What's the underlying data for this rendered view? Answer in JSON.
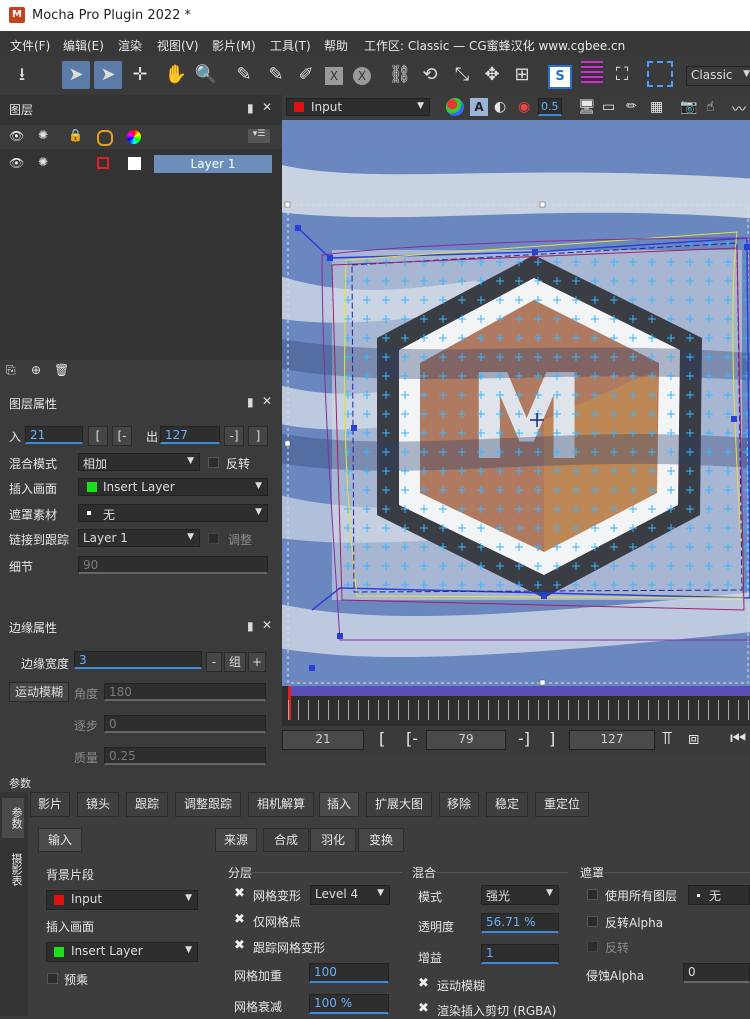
{
  "window": {
    "title": "Mocha Pro Plugin 2022 *",
    "app_icon": "M"
  },
  "menu": [
    "文件(F)",
    "编辑(E)",
    "渲染",
    "视图(V)",
    "影片(M)",
    "工具(T)",
    "帮助",
    "工作区: Classic — CG蜜蜂汉化 www.cgbee.cn"
  ],
  "toolbar": {
    "workspace_select": "Classic"
  },
  "layers_panel": {
    "title": "图层",
    "layers": [
      {
        "name": "Layer 1"
      }
    ]
  },
  "viewer": {
    "clip_select": "Input",
    "clip_color": "#e01010",
    "opacity_value": "0.5"
  },
  "layer_props": {
    "title": "图层属性",
    "in_label": "入",
    "in_value": "21",
    "out_label": "出",
    "out_value": "127",
    "blend_label": "混合模式",
    "blend_value": "相加",
    "invert_label": "反转",
    "insert_label": "插入画面",
    "insert_value": "Insert Layer",
    "matte_label": "遮罩素材",
    "matte_value": "无",
    "link_label": "链接到跟踪",
    "link_value": "Layer 1",
    "adjust_label": "调整",
    "detail_label": "细节",
    "detail_value": "90",
    "in_btns": [
      "[",
      "[-"
    ],
    "out_btns": [
      "-]",
      "]"
    ]
  },
  "edge_props": {
    "title": "边缘属性",
    "width_label": "边缘宽度",
    "width_value": "3",
    "group_btn": "组",
    "minus_btn": "-",
    "plus_btn": "+",
    "motion_blur_btn": "运动模糊",
    "angle_label": "角度",
    "angle_value": "180",
    "step_label": "逐步",
    "step_value": "0",
    "quality_label": "质量",
    "quality_value": "0.25",
    "params_label": "参数"
  },
  "timeline": {
    "current_frame": "21",
    "mid_frame": "79",
    "end_frame": "127",
    "btns": [
      "[",
      "[-",
      "-]",
      "]"
    ]
  },
  "side_tabs": [
    "参数",
    "摄影表"
  ],
  "bottom_tabs": [
    "影片",
    "镜头",
    "跟踪",
    "调整跟踪",
    "相机解算",
    "插入",
    "扩展大图",
    "移除",
    "稳定",
    "重定位"
  ],
  "insert_panel": {
    "input_tab": "输入",
    "subtabs": [
      "来源",
      "合成",
      "羽化",
      "变换"
    ],
    "bg_clip_label": "背景片段",
    "bg_clip_value": "Input",
    "insert_clip_label": "插入画面",
    "insert_clip_value": "Insert Layer",
    "premult_label": "预乘",
    "layers_section": "分层",
    "mesh_warp_label": "网格变形",
    "mesh_warp_value": "Level 4",
    "mesh_only_label": "仅网格点",
    "track_mesh_label": "跟踪网格变形",
    "mesh_weight_label": "网格加重",
    "mesh_weight_value": "100",
    "mesh_decay_label": "网格衰减",
    "mesh_decay_value": "100 %",
    "blend_section": "混合",
    "mode_label": "模式",
    "mode_value": "强光",
    "opacity_label": "透明度",
    "opacity_value": "56.71 %",
    "gain_label": "增益",
    "gain_value": "1",
    "motion_blur_label": "运动模糊",
    "render_cut_label": "渲染插入剪切 (RGBA)",
    "matte_section": "遮罩",
    "use_all_layers_label": "使用所有图层",
    "use_all_value": "无",
    "invert_alpha_label": "反转Alpha",
    "invert_label": "反转",
    "erode_alpha_label": "侵蚀Alpha",
    "erode_alpha_value": "0"
  },
  "colors": {
    "accent": "#3d8be0",
    "selection": "#5b7ba8",
    "layer_row": "#6b8fba"
  }
}
